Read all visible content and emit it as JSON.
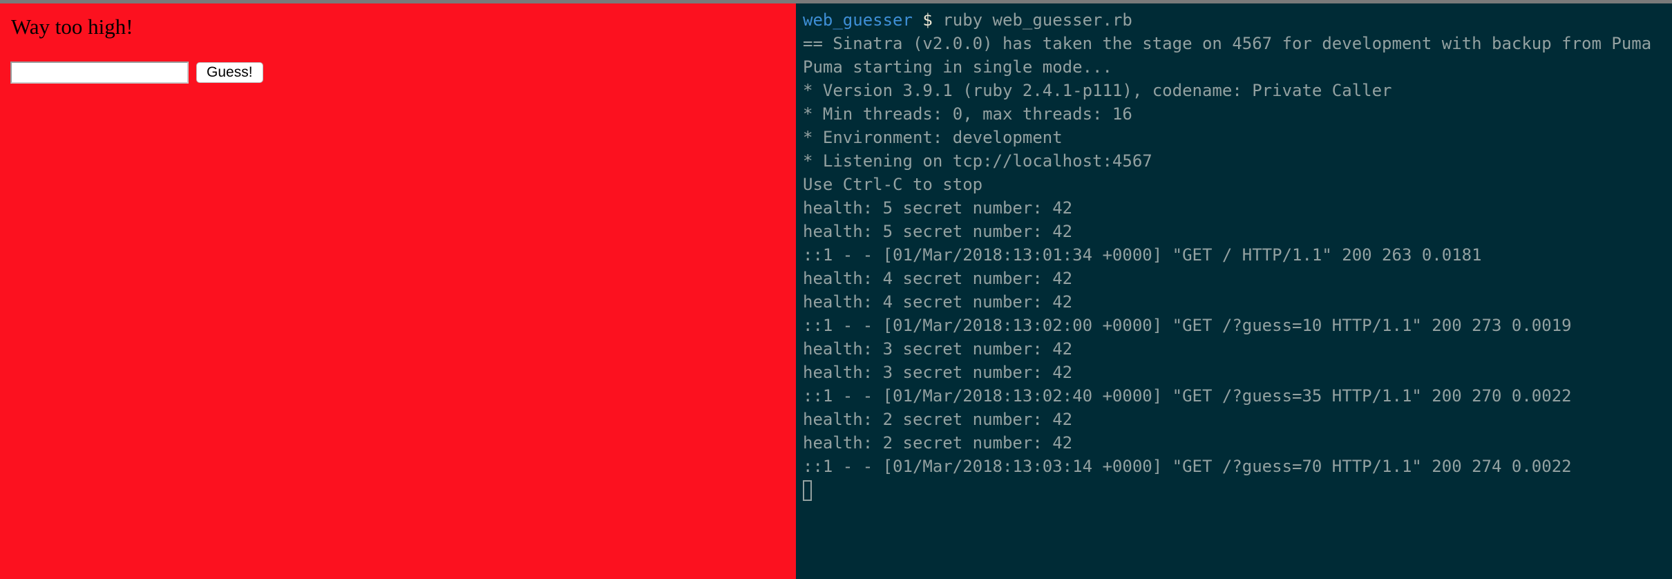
{
  "browser": {
    "message": "Way too high!",
    "guess_input_value": "",
    "guess_button_label": "Guess!",
    "background_color": "#fc111f"
  },
  "terminal": {
    "prompt_dir": "web_guesser",
    "prompt_symbol": "$",
    "command": "ruby web_guesser.rb",
    "lines": [
      "== Sinatra (v2.0.0) has taken the stage on 4567 for development with backup from Puma",
      "Puma starting in single mode...",
      "* Version 3.9.1 (ruby 2.4.1-p111), codename: Private Caller",
      "* Min threads: 0, max threads: 16",
      "* Environment: development",
      "* Listening on tcp://localhost:4567",
      "Use Ctrl-C to stop",
      "health: 5 secret number: 42",
      "health: 5 secret number: 42",
      "::1 - - [01/Mar/2018:13:01:34 +0000] \"GET / HTTP/1.1\" 200 263 0.0181",
      "health: 4 secret number: 42",
      "health: 4 secret number: 42",
      "::1 - - [01/Mar/2018:13:02:00 +0000] \"GET /?guess=10 HTTP/1.1\" 200 273 0.0019",
      "health: 3 secret number: 42",
      "health: 3 secret number: 42",
      "::1 - - [01/Mar/2018:13:02:40 +0000] \"GET /?guess=35 HTTP/1.1\" 200 270 0.0022",
      "health: 2 secret number: 42",
      "health: 2 secret number: 42",
      "::1 - - [01/Mar/2018:13:03:14 +0000] \"GET /?guess=70 HTTP/1.1\" 200 274 0.0022"
    ],
    "background_color": "#002b36",
    "text_color": "#93a1a1",
    "prompt_color": "#3e8fd6"
  }
}
